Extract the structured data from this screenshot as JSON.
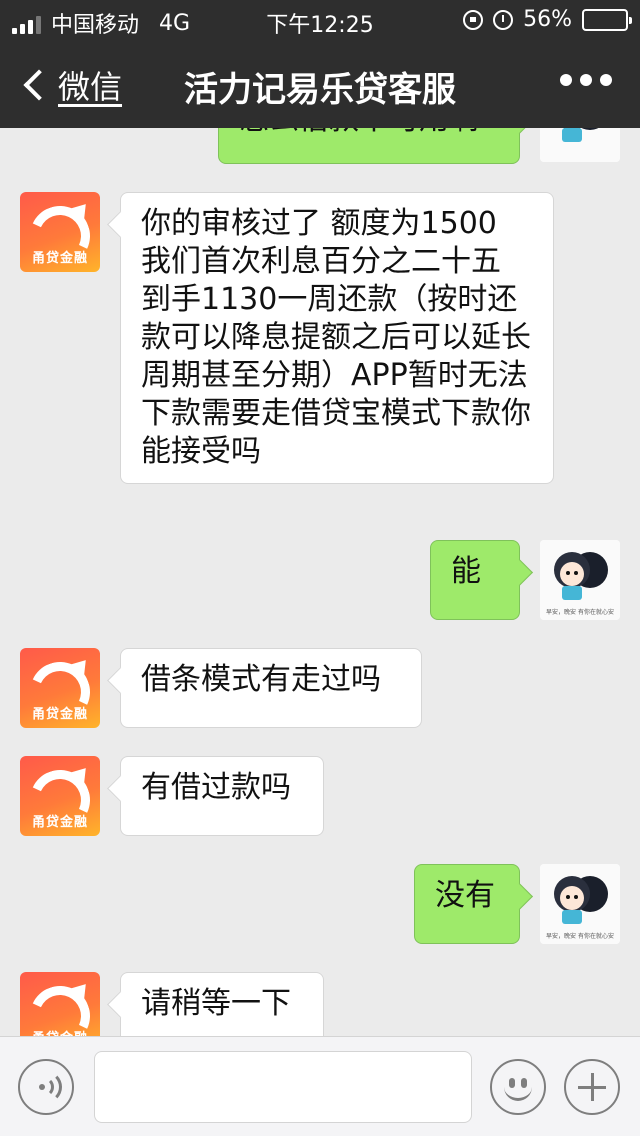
{
  "status_bar": {
    "carrier": "中国移动",
    "network": "4G",
    "time": "下午12:25",
    "battery_percent": "56%",
    "battery_level": 0.56,
    "signal_bars_active": 3,
    "icons": [
      "signal-icon",
      "orientation-lock-icon",
      "alarm-icon",
      "battery-icon"
    ]
  },
  "nav": {
    "back_label": "微信",
    "title": "活力记易乐贷客服",
    "more_icon": "more-dots-icon"
  },
  "bot_avatar": {
    "brand_text": "甬贷金融",
    "colors": [
      "#ff5a4a",
      "#ffb42a"
    ]
  },
  "user_avatar": {
    "caption": "早安，晚安 有你在就心安"
  },
  "messages": [
    {
      "side": "right",
      "text": "怎么借款不可用啊"
    },
    {
      "side": "left",
      "text": "你的审核过了 额度为1500 我们首次利息百分之二十五 到手1130一周还款（按时还款可以降息提额之后可以延长周期甚至分期）APP暂时无法下款需要走借贷宝模式下款你能接受吗"
    },
    {
      "side": "right",
      "text": "能"
    },
    {
      "side": "left",
      "text": "借条模式有走过吗"
    },
    {
      "side": "left",
      "text": "有借过款吗"
    },
    {
      "side": "right",
      "text": "没有"
    },
    {
      "side": "left",
      "text": "请稍等一下"
    }
  ],
  "input_bar": {
    "voice_icon": "voice-icon",
    "input_value": "",
    "emoji_icon": "emoji-icon",
    "plus_icon": "plus-icon"
  },
  "colors": {
    "nav_bg": "#2e2e2e",
    "chat_bg": "#ebebeb",
    "sent_bubble": "#9eea6a",
    "received_bubble": "#ffffff"
  }
}
